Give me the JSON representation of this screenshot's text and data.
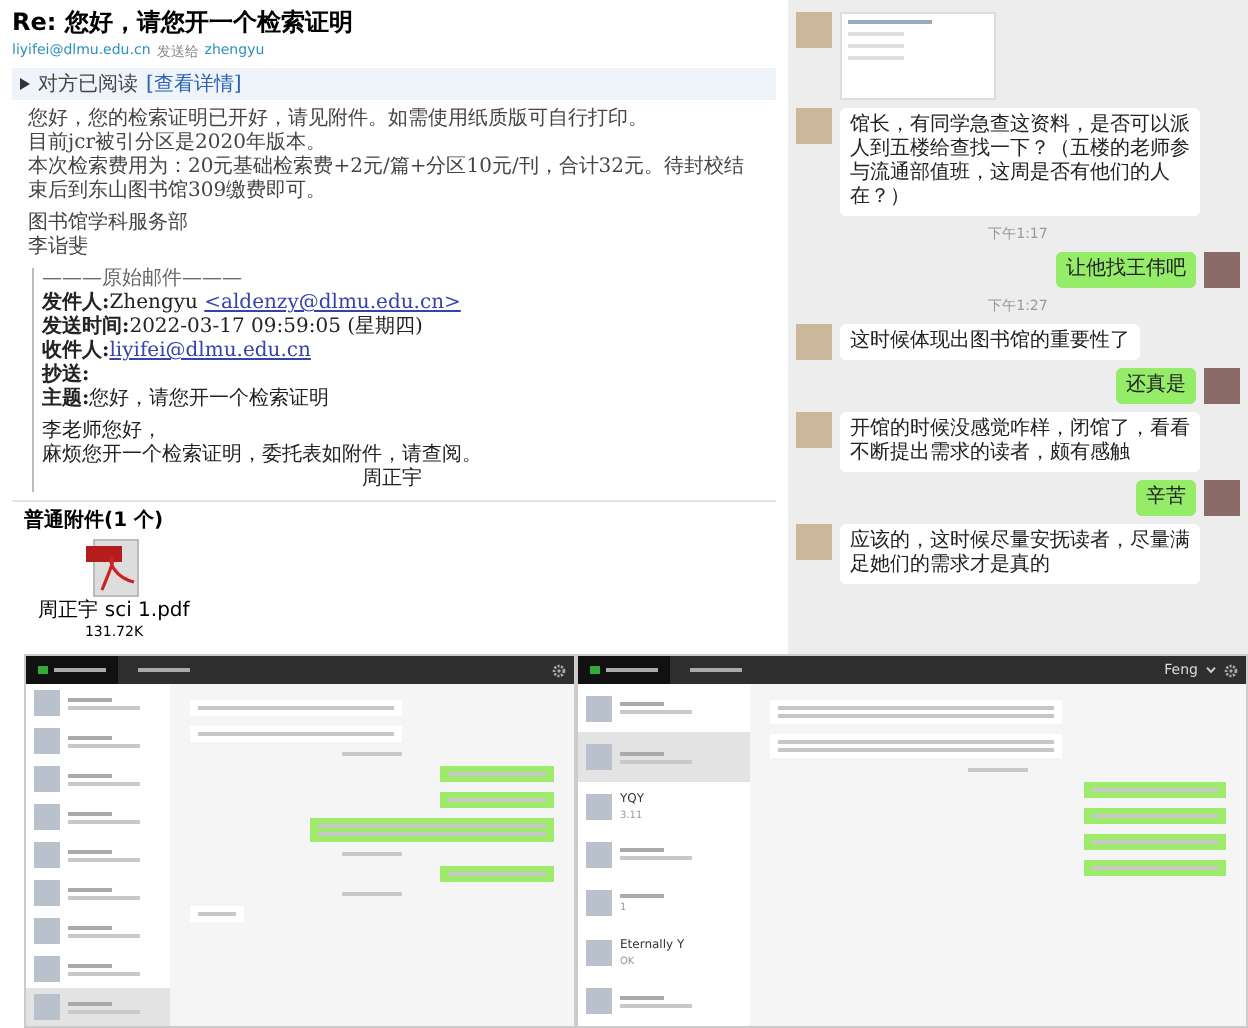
{
  "email": {
    "subject": "Re: 您好，请您开一个检索证明",
    "sender": "liyifei@dlmu.edu.cn",
    "sent_to_label": "发送给",
    "recipient": "zhengyu",
    "read_status": "对方已阅读",
    "details_link": "[查看详情]",
    "body": [
      "您好，您的检索证明已开好，请见附件。如需使用纸质版可自行打印。",
      "目前jcr被引分区是2020年版本。",
      "本次检索费用为：20元基础检索费+2元/篇+分区10元/刊，合计32元。待封校结束后到东山图书馆309缴费即可。"
    ],
    "signature": [
      "图书馆学科服务部",
      "李诣斐"
    ],
    "original": {
      "header": "———原始邮件———",
      "fields": [
        {
          "label": "发件人:",
          "value": "Zhengyu ",
          "link": "<aldenzy@dlmu.edu.cn>"
        },
        {
          "label": "发送时间:",
          "value": "2022-03-17 09:59:05 (星期四)"
        },
        {
          "label": "收件人:",
          "link": "liyifei@dlmu.edu.cn"
        },
        {
          "label": "抄送:"
        },
        {
          "label": "主题:",
          "value": "您好，请您开一个检索证明"
        }
      ],
      "greeting": "李老师您好，",
      "text": "麻烦您开一个检索证明，委托表如附件，请查阅。",
      "sign": "周正宇"
    },
    "attachments": {
      "title": "普通附件(1 个)",
      "files": [
        {
          "name": "周正宇 sci 1.pdf",
          "size": "131.72K"
        }
      ]
    }
  },
  "chat": {
    "messages": [
      {
        "kind": "incoming-image"
      },
      {
        "kind": "incoming",
        "text": "馆长，有同学急查这资料，是否可以派人到五楼给查找一下？（五楼的老师参与流通部值班，这周是否有他们的人在？）"
      },
      {
        "kind": "time",
        "text": "下午1:17"
      },
      {
        "kind": "outgoing",
        "text": "让他找王伟吧"
      },
      {
        "kind": "time",
        "text": "下午1:27"
      },
      {
        "kind": "incoming",
        "text": "这时候体现出图书馆的重要性了"
      },
      {
        "kind": "outgoing",
        "text": "还真是"
      },
      {
        "kind": "incoming",
        "text": "开馆的时候没感觉咋样，闭馆了，看看不断提出需求的读者，颇有感触"
      },
      {
        "kind": "outgoing",
        "text": "辛苦"
      },
      {
        "kind": "incoming",
        "text": "应该的，这时候尽量安抚读者，尽量满足她们的需求才是真的"
      }
    ]
  },
  "desktop_chat_left": {
    "contacts": [
      {
        "selected": false
      },
      {
        "selected": false
      },
      {
        "selected": false
      },
      {
        "selected": false
      },
      {
        "selected": false
      },
      {
        "selected": false
      },
      {
        "selected": false
      },
      {
        "selected": false
      },
      {
        "selected": true
      }
    ],
    "messages": [
      {
        "kind": "incoming"
      },
      {
        "kind": "incoming"
      },
      {
        "kind": "time"
      },
      {
        "kind": "outgoing"
      },
      {
        "kind": "outgoing"
      },
      {
        "kind": "outgoing-long"
      },
      {
        "kind": "time"
      },
      {
        "kind": "outgoing"
      },
      {
        "kind": "time"
      },
      {
        "kind": "incoming-short"
      }
    ]
  },
  "desktop_chat_right": {
    "user": "Feng",
    "contacts": [
      {
        "selected": false
      },
      {
        "selected": true
      },
      {
        "name": "YQY",
        "preview": "3.11",
        "selected": false
      },
      {
        "selected": false
      },
      {
        "preview": "1",
        "selected": false
      },
      {
        "name": "Eternally Y",
        "preview": "OK",
        "selected": false
      },
      {
        "selected": false
      }
    ],
    "messages": [
      {
        "kind": "incoming-long"
      },
      {
        "kind": "incoming-long"
      },
      {
        "kind": "time"
      },
      {
        "kind": "outgoing"
      },
      {
        "kind": "outgoing"
      },
      {
        "kind": "outgoing"
      },
      {
        "kind": "outgoing"
      }
    ]
  }
}
